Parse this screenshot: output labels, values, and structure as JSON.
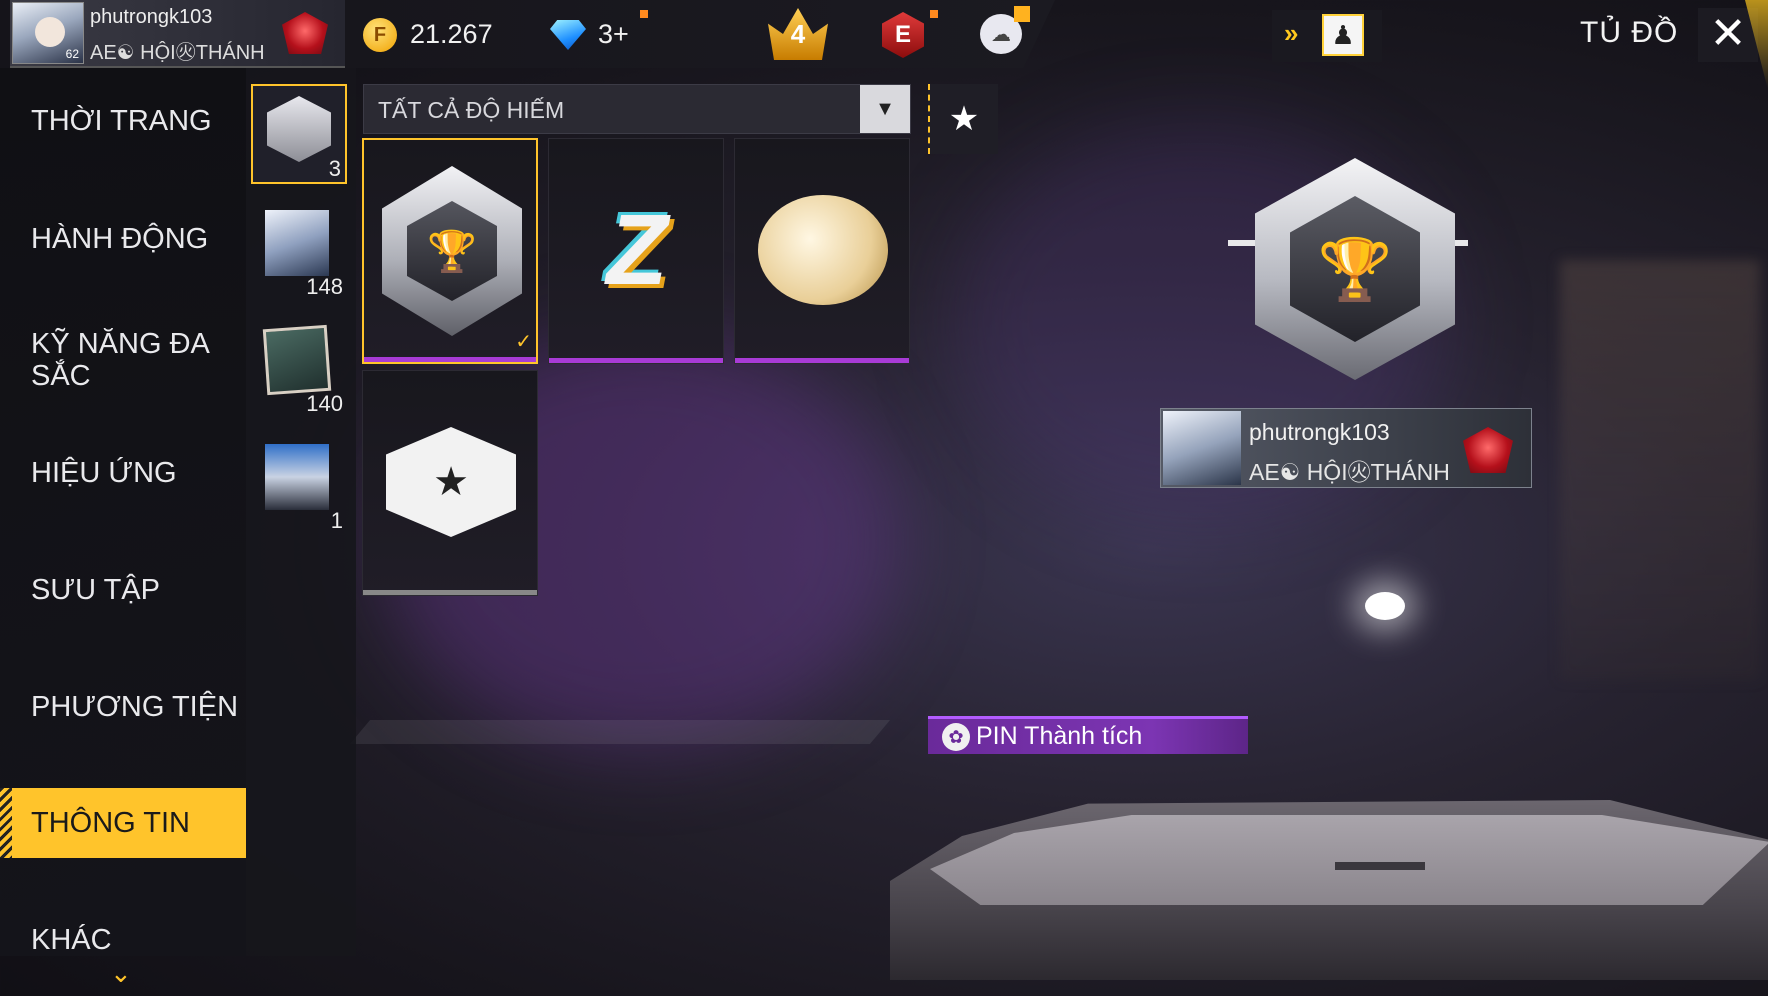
{
  "header": {
    "player_name": "phutrongk103",
    "player_level": "62",
    "guild": "AE☯ HỘI㊋THÁNH",
    "coins": "21.267",
    "diamonds": "3+",
    "crown_level": "4",
    "elite_label": "E",
    "title": "TỦ ĐỒ",
    "close_symbol": "✕"
  },
  "menu": {
    "items": [
      {
        "label": "THỜI TRANG"
      },
      {
        "label": "HÀNH ĐỘNG"
      },
      {
        "label": "KỸ NĂNG ĐA SẮC"
      },
      {
        "label": "HIỆU ỨNG"
      },
      {
        "label": "SƯU TẬP"
      },
      {
        "label": "PHƯƠNG TIỆN"
      },
      {
        "label": "THÔNG TIN"
      },
      {
        "label": "KHÁC"
      }
    ],
    "active": "THÔNG TIN",
    "more_symbol": "⌄"
  },
  "categories": [
    {
      "count": "3",
      "icon": "trophy-badge-icon"
    },
    {
      "count": "148",
      "icon": "avatar-icon"
    },
    {
      "count": "140",
      "icon": "banner-card-icon"
    },
    {
      "count": "1",
      "icon": "character-pin-icon"
    }
  ],
  "filter": {
    "label": "TẤT CẢ ĐỘ HIẾM",
    "dropdown_symbol": "▼",
    "favorite_symbol": "★"
  },
  "items": [
    {
      "icon": "trophy-badge-icon",
      "symbol": "🏆",
      "selected": true,
      "rarity_color": "#a83bd6"
    },
    {
      "icon": "lightning-z-icon",
      "symbol": "Z",
      "selected": false,
      "rarity_color": "#a83bd6"
    },
    {
      "icon": "swirl-emblem-icon",
      "symbol": "",
      "selected": false,
      "rarity_color": "#a83bd6"
    },
    {
      "icon": "star-shield-icon",
      "symbol": "★",
      "selected": false,
      "rarity_color": "#888888"
    }
  ],
  "check_symbol": "✓",
  "preview": {
    "badge_symbol": "🏆",
    "name": "phutrongk103",
    "guild": "AE☯ HỘI㊋THÁNH"
  },
  "pin_button": {
    "label": "PIN Thành tích",
    "icon_symbol": "✿"
  },
  "colors": {
    "accent": "#ffc42b",
    "rarity_purple": "#a83bd6",
    "pin_purple": "#7c35b3"
  }
}
